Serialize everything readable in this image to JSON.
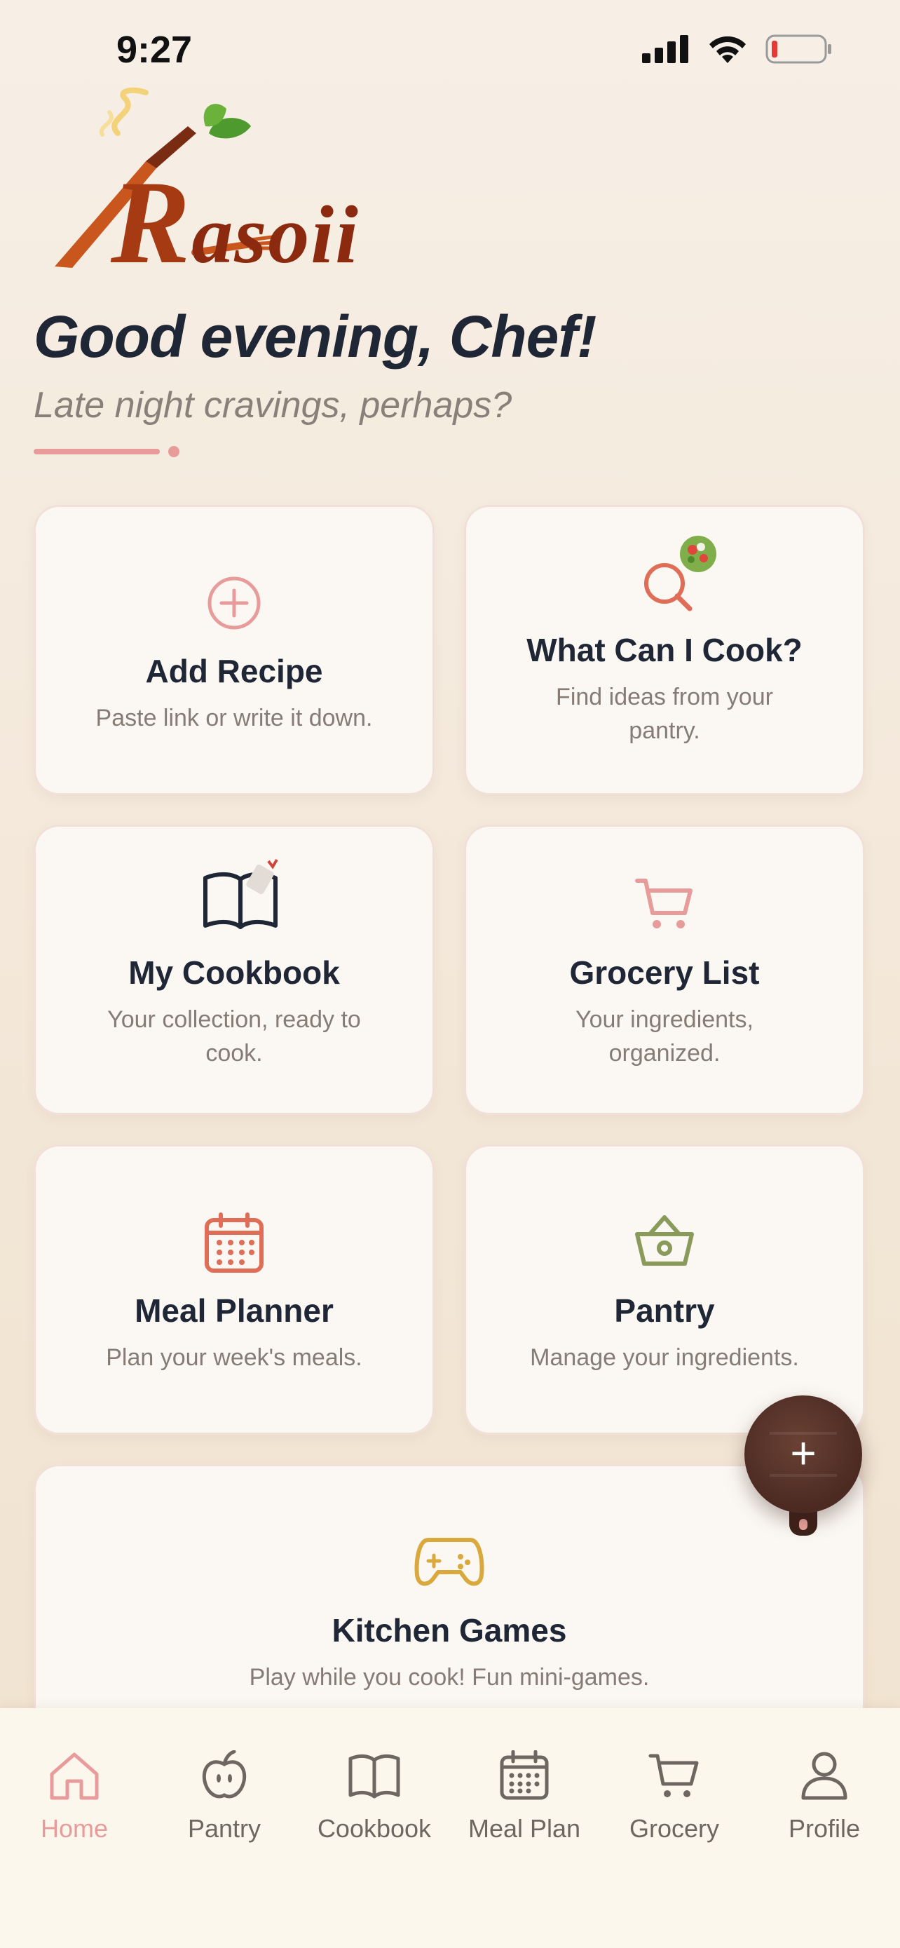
{
  "status": {
    "time": "9:27"
  },
  "logo": {
    "first_letter": "R",
    "rest": "asoii"
  },
  "greeting": {
    "title": "Good evening, Chef!",
    "subtitle": "Late night cravings, perhaps?"
  },
  "cards": {
    "add_recipe": {
      "title": "Add Recipe",
      "desc": "Paste link or write it down."
    },
    "what_can_i_cook": {
      "title": "What Can I Cook?",
      "desc": "Find ideas from your pantry."
    },
    "my_cookbook": {
      "title": "My Cookbook",
      "desc": "Your collection, ready to cook."
    },
    "grocery_list": {
      "title": "Grocery List",
      "desc": "Your ingredients, organized."
    },
    "meal_planner": {
      "title": "Meal Planner",
      "desc": "Plan your week's meals."
    },
    "pantry": {
      "title": "Pantry",
      "desc": "Manage your ingredients."
    },
    "kitchen_games": {
      "title": "Kitchen Games",
      "desc": "Play while you cook! Fun mini-games."
    }
  },
  "fab": {
    "icon": "plus-icon",
    "label": "+"
  },
  "nav": {
    "home": "Home",
    "pantry": "Pantry",
    "cookbook": "Cookbook",
    "meal_plan": "Meal Plan",
    "grocery": "Grocery",
    "profile": "Profile"
  },
  "colors": {
    "accent_pink": "#e89b9b",
    "coral": "#e06d57",
    "olive": "#8a9a5b",
    "gold": "#d9a93e",
    "navy": "#1f2636"
  }
}
